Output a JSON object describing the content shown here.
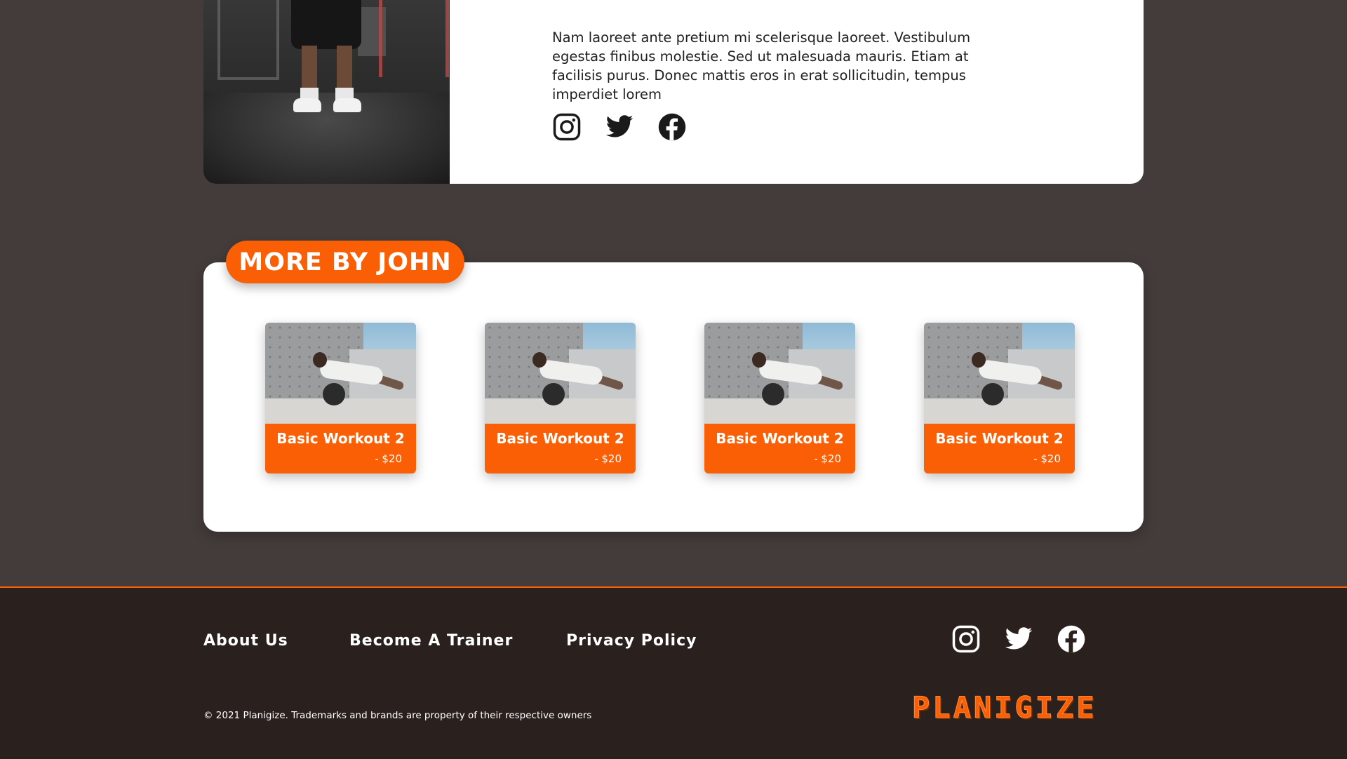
{
  "profile": {
    "bio": "Nam laoreet ante pretium mi scelerisque laoreet. Vestibulum egestas finibus molestie. Sed ut malesuada mauris. Etiam at facilisis purus. Donec mattis eros in erat sollicitudin, tempus imperdiet lorem",
    "social_icons": [
      "instagram-icon",
      "twitter-icon",
      "facebook-icon"
    ]
  },
  "more_section": {
    "title": "More by John",
    "workouts": [
      {
        "title": "Basic Workout 2",
        "price": "- $20"
      },
      {
        "title": "Basic Workout 2",
        "price": "- $20"
      },
      {
        "title": "Basic Workout 2",
        "price": "- $20"
      },
      {
        "title": "Basic Workout 2",
        "price": "- $20"
      }
    ]
  },
  "footer": {
    "links": [
      "About Us",
      "Become A Trainer",
      "Privacy Policy"
    ],
    "social_icons": [
      "instagram-icon",
      "twitter-icon",
      "facebook-icon"
    ],
    "copyright": "© 2021 Planigize. Trademarks and brands are property of their respective owners",
    "brand": "PLANIGIZE"
  },
  "colors": {
    "accent": "#fb5f05",
    "page_background": "#443c3a",
    "footer_background": "#2a211e",
    "card_background": "#ffffff"
  }
}
